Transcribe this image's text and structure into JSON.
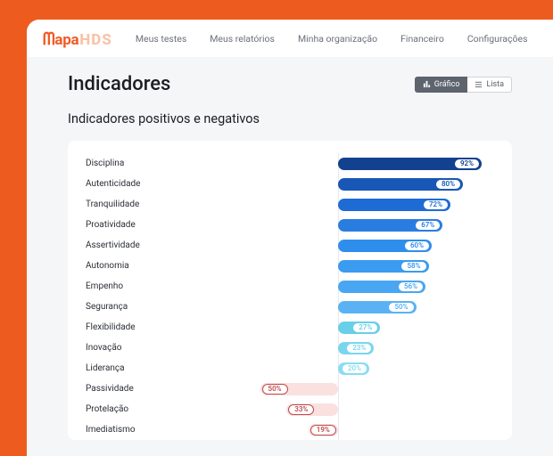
{
  "brand": {
    "mapa": "Mapa",
    "hds": "HDS"
  },
  "nav": {
    "items": [
      {
        "label": "Meus testes"
      },
      {
        "label": "Meus relatórios"
      },
      {
        "label": "Minha organização"
      },
      {
        "label": "Financeiro"
      },
      {
        "label": "Configurações"
      }
    ]
  },
  "page": {
    "title": "Indicadores",
    "subtitle": "Indicadores positivos e negativos"
  },
  "toggle": {
    "chart_label": "Gráfico",
    "list_label": "Lista"
  },
  "chart_data": {
    "type": "bar",
    "title": "Indicadores positivos e negativos",
    "xlabel": "",
    "ylabel": "",
    "xlim": [
      -100,
      100
    ],
    "series": [
      {
        "name": "Disciplina",
        "value": 92,
        "display": "92%",
        "color": "#12418f"
      },
      {
        "name": "Autenticidade",
        "value": 80,
        "display": "80%",
        "color": "#1857b5"
      },
      {
        "name": "Tranquilidade",
        "value": 72,
        "display": "72%",
        "color": "#1e6bd6"
      },
      {
        "name": "Proatividade",
        "value": 67,
        "display": "67%",
        "color": "#2a7de0"
      },
      {
        "name": "Assertividade",
        "value": 60,
        "display": "60%",
        "color": "#2f8eeb"
      },
      {
        "name": "Autonomia",
        "value": 58,
        "display": "58%",
        "color": "#3a9bf0"
      },
      {
        "name": "Empenho",
        "value": 56,
        "display": "56%",
        "color": "#49a6f2"
      },
      {
        "name": "Segurança",
        "value": 50,
        "display": "50%",
        "color": "#5ab2f5"
      },
      {
        "name": "Flexibilidade",
        "value": 27,
        "display": "27%",
        "color": "#69cfe9"
      },
      {
        "name": "Inovação",
        "value": 23,
        "display": "23%",
        "color": "#79d6ef"
      },
      {
        "name": "Liderança",
        "value": 20,
        "display": "20%",
        "color": "#89ddf3"
      },
      {
        "name": "Passividade",
        "value": -50,
        "display": "50%",
        "color": "#fbe0e0",
        "text": "#c04a4a"
      },
      {
        "name": "Protelação",
        "value": -33,
        "display": "33%",
        "color": "#fbe0e0",
        "text": "#c04a4a"
      },
      {
        "name": "Imediatismo",
        "value": -19,
        "display": "19%",
        "color": "#fbe0e0",
        "text": "#c04a4a"
      }
    ]
  }
}
